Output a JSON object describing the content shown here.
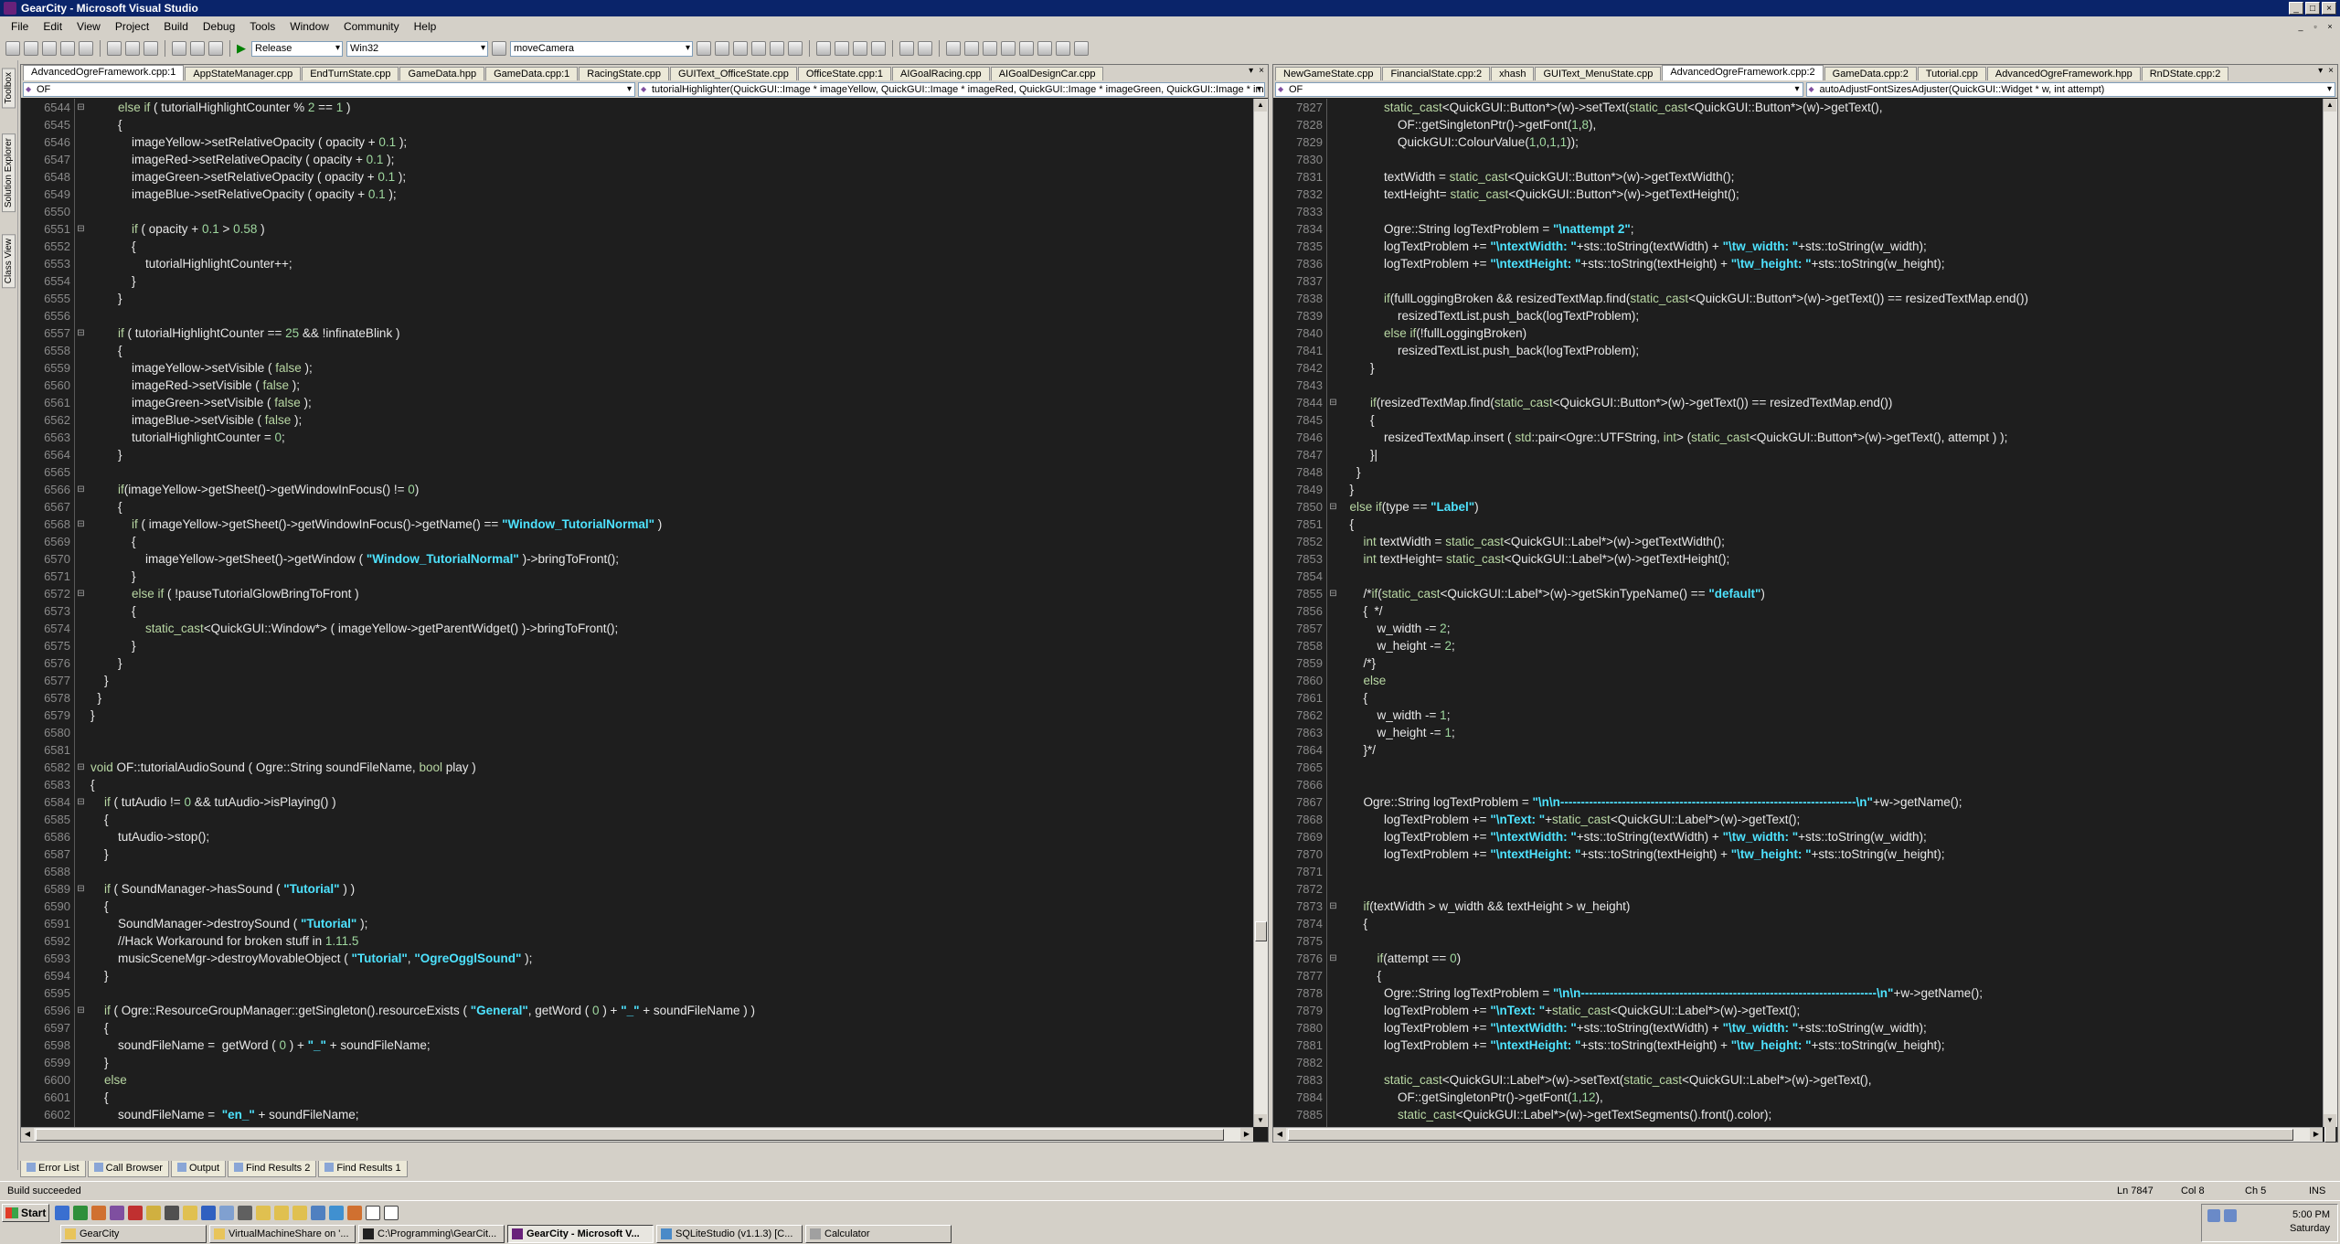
{
  "window": {
    "title": "GearCity - Microsoft Visual Studio"
  },
  "menu": [
    "File",
    "Edit",
    "View",
    "Project",
    "Build",
    "Debug",
    "Tools",
    "Window",
    "Community",
    "Help"
  ],
  "toolbar": {
    "config": "Release",
    "platform": "Win32",
    "find": "moveCamera"
  },
  "side_tabs": [
    "Toolbox",
    "Solution Explorer",
    "Class View"
  ],
  "left_pane": {
    "tabs": [
      "AdvancedOgreFramework.cpp:1",
      "AppStateManager.cpp",
      "EndTurnState.cpp",
      "GameData.hpp",
      "GameData.cpp:1",
      "RacingState.cpp",
      "GUIText_OfficeState.cpp",
      "OfficeState.cpp:1",
      "AIGoalRacing.cpp",
      "AIGoalDesignCar.cpp"
    ],
    "active_tab": 0,
    "scope": "OF",
    "member": "tutorialHighlighter(QuickGUI::Image * imageYellow, QuickGUI::Image * imageRed, QuickGUI::Image * imageGreen, QuickGUI::Image * imageBlue)",
    "lines": [
      {
        "n": "6544",
        "c": "        else if ( tutorialHighlightCounter % 2 == 1 )",
        "f": "fold"
      },
      {
        "n": "6545",
        "c": "        {"
      },
      {
        "n": "6546",
        "c": "            imageYellow->setRelativeOpacity ( opacity + 0.1 );"
      },
      {
        "n": "6547",
        "c": "            imageRed->setRelativeOpacity ( opacity + 0.1 );"
      },
      {
        "n": "6548",
        "c": "            imageGreen->setRelativeOpacity ( opacity + 0.1 );"
      },
      {
        "n": "6549",
        "c": "            imageBlue->setRelativeOpacity ( opacity + 0.1 );"
      },
      {
        "n": "6550",
        "c": ""
      },
      {
        "n": "6551",
        "c": "            if ( opacity + 0.1 > 0.58 )",
        "f": "fold"
      },
      {
        "n": "6552",
        "c": "            {"
      },
      {
        "n": "6553",
        "c": "                tutorialHighlightCounter++;"
      },
      {
        "n": "6554",
        "c": "            }"
      },
      {
        "n": "6555",
        "c": "        }"
      },
      {
        "n": "6556",
        "c": ""
      },
      {
        "n": "6557",
        "c": "        if ( tutorialHighlightCounter == 25 && !infinateBlink )",
        "f": "fold"
      },
      {
        "n": "6558",
        "c": "        {"
      },
      {
        "n": "6559",
        "c": "            imageYellow->setVisible ( false );"
      },
      {
        "n": "6560",
        "c": "            imageRed->setVisible ( false );"
      },
      {
        "n": "6561",
        "c": "            imageGreen->setVisible ( false );"
      },
      {
        "n": "6562",
        "c": "            imageBlue->setVisible ( false );"
      },
      {
        "n": "6563",
        "c": "            tutorialHighlightCounter = 0;"
      },
      {
        "n": "6564",
        "c": "        }"
      },
      {
        "n": "6565",
        "c": ""
      },
      {
        "n": "6566",
        "c": "        if(imageYellow->getSheet()->getWindowInFocus() != 0)",
        "f": "fold"
      },
      {
        "n": "6567",
        "c": "        {"
      },
      {
        "n": "6568",
        "c": "            if ( imageYellow->getSheet()->getWindowInFocus()->getName() == \"Window_TutorialNormal\" )",
        "f": "fold"
      },
      {
        "n": "6569",
        "c": "            {"
      },
      {
        "n": "6570",
        "c": "                imageYellow->getSheet()->getWindow ( \"Window_TutorialNormal\" )->bringToFront();"
      },
      {
        "n": "6571",
        "c": "            }"
      },
      {
        "n": "6572",
        "c": "            else if ( !pauseTutorialGlowBringToFront )",
        "f": "fold"
      },
      {
        "n": "6573",
        "c": "            {"
      },
      {
        "n": "6574",
        "c": "                static_cast<QuickGUI::Window*> ( imageYellow->getParentWidget() )->bringToFront();"
      },
      {
        "n": "6575",
        "c": "            }"
      },
      {
        "n": "6576",
        "c": "        }"
      },
      {
        "n": "6577",
        "c": "    }"
      },
      {
        "n": "6578",
        "c": "  }"
      },
      {
        "n": "6579",
        "c": "}"
      },
      {
        "n": "6580",
        "c": ""
      },
      {
        "n": "6581",
        "c": ""
      },
      {
        "n": "6582",
        "c": "void OF::tutorialAudioSound ( Ogre::String soundFileName, bool play )",
        "f": "fold"
      },
      {
        "n": "6583",
        "c": "{"
      },
      {
        "n": "6584",
        "c": "    if ( tutAudio != 0 && tutAudio->isPlaying() )",
        "f": "fold"
      },
      {
        "n": "6585",
        "c": "    {"
      },
      {
        "n": "6586",
        "c": "        tutAudio->stop();"
      },
      {
        "n": "6587",
        "c": "    }"
      },
      {
        "n": "6588",
        "c": ""
      },
      {
        "n": "6589",
        "c": "    if ( SoundManager->hasSound ( \"Tutorial\" ) )",
        "f": "fold"
      },
      {
        "n": "6590",
        "c": "    {"
      },
      {
        "n": "6591",
        "c": "        SoundManager->destroySound ( \"Tutorial\" );"
      },
      {
        "n": "6592",
        "c": "        //Hack Workaround for broken stuff in 1.11.5"
      },
      {
        "n": "6593",
        "c": "        musicSceneMgr->destroyMovableObject ( \"Tutorial\", \"OgreOgglSound\" );"
      },
      {
        "n": "6594",
        "c": "    }"
      },
      {
        "n": "6595",
        "c": ""
      },
      {
        "n": "6596",
        "c": "    if ( Ogre::ResourceGroupManager::getSingleton().resourceExists ( \"General\", getWord ( 0 ) + \"_\" + soundFileName ) )",
        "f": "fold"
      },
      {
        "n": "6597",
        "c": "    {"
      },
      {
        "n": "6598",
        "c": "        soundFileName =  getWord ( 0 ) + \"_\" + soundFileName;"
      },
      {
        "n": "6599",
        "c": "    }"
      },
      {
        "n": "6600",
        "c": "    else"
      },
      {
        "n": "6601",
        "c": "    {"
      },
      {
        "n": "6602",
        "c": "        soundFileName =  \"en_\" + soundFileName;"
      },
      {
        "n": "6603",
        "c": "    }"
      }
    ]
  },
  "right_pane": {
    "tabs": [
      "NewGameState.cpp",
      "FinancialState.cpp:2",
      "xhash",
      "GUIText_MenuState.cpp",
      "AdvancedOgreFramework.cpp:2",
      "GameData.cpp:2",
      "Tutorial.cpp",
      "AdvancedOgreFramework.hpp",
      "RnDState.cpp:2"
    ],
    "active_tab": 4,
    "scope": "OF",
    "member": "autoAdjustFontSizesAdjuster(QuickGUI::Widget * w, int attempt)",
    "lines": [
      {
        "n": "7827",
        "c": "            static_cast<QuickGUI::Button*>(w)->setText(static_cast<QuickGUI::Button*>(w)->getText(),"
      },
      {
        "n": "7828",
        "c": "                OF::getSingletonPtr()->getFont(1,8),"
      },
      {
        "n": "7829",
        "c": "                QuickGUI::ColourValue(1,0,1,1));"
      },
      {
        "n": "7830",
        "c": ""
      },
      {
        "n": "7831",
        "c": "            textWidth = static_cast<QuickGUI::Button*>(w)->getTextWidth();"
      },
      {
        "n": "7832",
        "c": "            textHeight= static_cast<QuickGUI::Button*>(w)->getTextHeight();"
      },
      {
        "n": "7833",
        "c": ""
      },
      {
        "n": "7834",
        "c": "            Ogre::String logTextProblem = \"\\nattempt 2\";"
      },
      {
        "n": "7835",
        "c": "            logTextProblem += \"\\ntextWidth: \"+sts::toString(textWidth) + \"\\tw_width: \"+sts::toString(w_width);"
      },
      {
        "n": "7836",
        "c": "            logTextProblem += \"\\ntextHeight: \"+sts::toString(textHeight) + \"\\tw_height: \"+sts::toString(w_height);"
      },
      {
        "n": "7837",
        "c": ""
      },
      {
        "n": "7838",
        "c": "            if(fullLoggingBroken && resizedTextMap.find(static_cast<QuickGUI::Button*>(w)->getText()) == resizedTextMap.end())"
      },
      {
        "n": "7839",
        "c": "                resizedTextList.push_back(logTextProblem);"
      },
      {
        "n": "7840",
        "c": "            else if(!fullLoggingBroken)"
      },
      {
        "n": "7841",
        "c": "                resizedTextList.push_back(logTextProblem);"
      },
      {
        "n": "7842",
        "c": "        }"
      },
      {
        "n": "7843",
        "c": ""
      },
      {
        "n": "7844",
        "c": "        if(resizedTextMap.find(static_cast<QuickGUI::Button*>(w)->getText()) == resizedTextMap.end())",
        "f": "fold"
      },
      {
        "n": "7845",
        "c": "        {"
      },
      {
        "n": "7846",
        "c": "            resizedTextMap.insert ( std::pair<Ogre::UTFString, int> (static_cast<QuickGUI::Button*>(w)->getText(), attempt ) );"
      },
      {
        "n": "7847",
        "c": "        }|"
      },
      {
        "n": "7848",
        "c": "    }"
      },
      {
        "n": "7849",
        "c": "  }"
      },
      {
        "n": "7850",
        "c": "  else if(type == \"Label\")",
        "f": "fold"
      },
      {
        "n": "7851",
        "c": "  {"
      },
      {
        "n": "7852",
        "c": "      int textWidth = static_cast<QuickGUI::Label*>(w)->getTextWidth();"
      },
      {
        "n": "7853",
        "c": "      int textHeight= static_cast<QuickGUI::Label*>(w)->getTextHeight();"
      },
      {
        "n": "7854",
        "c": ""
      },
      {
        "n": "7855",
        "c": "      /*if(static_cast<QuickGUI::Label*>(w)->getSkinTypeName() == \"default\")",
        "f": "fold"
      },
      {
        "n": "7856",
        "c": "      {  */"
      },
      {
        "n": "7857",
        "c": "          w_width -= 2;"
      },
      {
        "n": "7858",
        "c": "          w_height -= 2;"
      },
      {
        "n": "7859",
        "c": "      /*}"
      },
      {
        "n": "7860",
        "c": "      else"
      },
      {
        "n": "7861",
        "c": "      {"
      },
      {
        "n": "7862",
        "c": "          w_width -= 1;"
      },
      {
        "n": "7863",
        "c": "          w_height -= 1;"
      },
      {
        "n": "7864",
        "c": "      }*/"
      },
      {
        "n": "7865",
        "c": ""
      },
      {
        "n": "7866",
        "c": ""
      },
      {
        "n": "7867",
        "c": "      Ogre::String logTextProblem = \"\\n\\n------------------------------------------------------------------------\\n\"+w->getName();"
      },
      {
        "n": "7868",
        "c": "            logTextProblem += \"\\nText: \"+static_cast<QuickGUI::Label*>(w)->getText();"
      },
      {
        "n": "7869",
        "c": "            logTextProblem += \"\\ntextWidth: \"+sts::toString(textWidth) + \"\\tw_width: \"+sts::toString(w_width);"
      },
      {
        "n": "7870",
        "c": "            logTextProblem += \"\\ntextHeight: \"+sts::toString(textHeight) + \"\\tw_height: \"+sts::toString(w_height);"
      },
      {
        "n": "7871",
        "c": ""
      },
      {
        "n": "7872",
        "c": ""
      },
      {
        "n": "7873",
        "c": "      if(textWidth > w_width && textHeight > w_height)",
        "f": "fold"
      },
      {
        "n": "7874",
        "c": "      {"
      },
      {
        "n": "7875",
        "c": ""
      },
      {
        "n": "7876",
        "c": "          if(attempt == 0)",
        "f": "fold"
      },
      {
        "n": "7877",
        "c": "          {"
      },
      {
        "n": "7878",
        "c": "            Ogre::String logTextProblem = \"\\n\\n------------------------------------------------------------------------\\n\"+w->getName();"
      },
      {
        "n": "7879",
        "c": "            logTextProblem += \"\\nText: \"+static_cast<QuickGUI::Label*>(w)->getText();"
      },
      {
        "n": "7880",
        "c": "            logTextProblem += \"\\ntextWidth: \"+sts::toString(textWidth) + \"\\tw_width: \"+sts::toString(w_width);"
      },
      {
        "n": "7881",
        "c": "            logTextProblem += \"\\ntextHeight: \"+sts::toString(textHeight) + \"\\tw_height: \"+sts::toString(w_height);"
      },
      {
        "n": "7882",
        "c": ""
      },
      {
        "n": "7883",
        "c": "            static_cast<QuickGUI::Label*>(w)->setText(static_cast<QuickGUI::Label*>(w)->getText(),"
      },
      {
        "n": "7884",
        "c": "                OF::getSingletonPtr()->getFont(1,12),"
      },
      {
        "n": "7885",
        "c": "                static_cast<QuickGUI::Label*>(w)->getTextSegments().front().color);"
      },
      {
        "n": "7886",
        "c": ""
      }
    ]
  },
  "bottom_tabs": [
    "Error List",
    "Call Browser",
    "Output",
    "Find Results 2",
    "Find Results 1"
  ],
  "status": {
    "message": "Build succeeded",
    "ln": "Ln 7847",
    "col": "Col 8",
    "ch": "Ch 5",
    "ins": "INS"
  },
  "taskbar": {
    "start": "Start",
    "buttons": [
      "GearCity",
      "VirtualMachineShare on '...",
      "C:\\Programming\\GearCit...",
      "GearCity - Microsoft V...",
      "SQLiteStudio (v1.1.3) [C...",
      "Calculator"
    ],
    "active": 3,
    "time": "5:00 PM",
    "day": "Saturday"
  },
  "colors": {
    "editor_bg": "#1e1e1e",
    "string": "#4ee3ff",
    "keyword": "#b8d7a3",
    "titlebar": "#0a246a"
  }
}
